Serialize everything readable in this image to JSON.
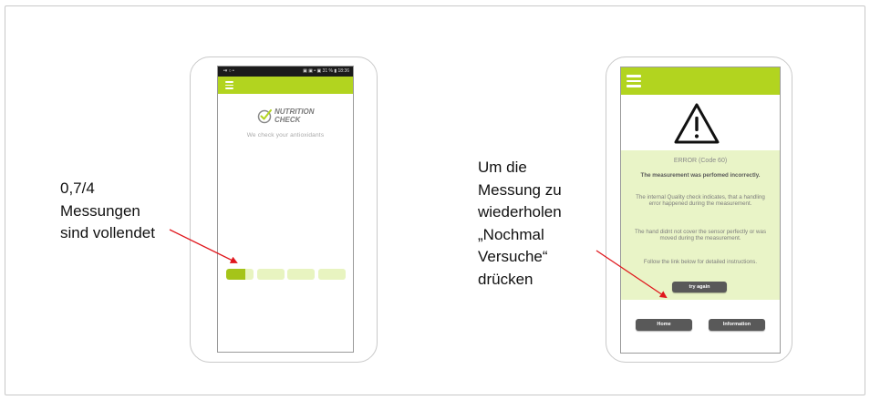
{
  "annotations": {
    "left": [
      "0,7/4",
      "Messungen",
      "sind vollendet"
    ],
    "right": [
      "Um die",
      "Messung zu",
      "wiederholen",
      "„Nochmal",
      "Versuche“",
      "drücken"
    ]
  },
  "left_phone": {
    "statusbar": {
      "left": "•▾ ○ •",
      "right": "▣ ▣ • ▣ 31 % ▮ 18:36"
    },
    "logo": {
      "line1": "NUTRITION",
      "line2": "CHECK"
    },
    "tagline": "We check your antioxidants",
    "progress": {
      "completed_measurements": 0.7,
      "total_measurements": 4
    }
  },
  "right_phone": {
    "error_code": "ERROR (Code 60)",
    "error_heading": "The measurement was perfomed incorrectly.",
    "paragraph_1": "The internal Quality check indicates, that a handling error happened during the measurement.",
    "paragraph_2": "The hand didnt not cover the sensor perfectly or was moved during the measurement.",
    "paragraph_3": "Follow the link below for detailed instructions.",
    "try_again_label": "try again",
    "home_label": "Home",
    "information_label": "Information"
  },
  "colors": {
    "accent_green": "#b2d41f",
    "progress_fill": "#a5c419",
    "progress_empty": "#e8f4c0",
    "panel_background": "#e9f4c7",
    "button_gray": "#595959",
    "arrow_red": "#e0161c"
  },
  "icons": [
    "hamburger-menu-icon",
    "nutrition-check-logo-icon",
    "warning-triangle-icon"
  ]
}
